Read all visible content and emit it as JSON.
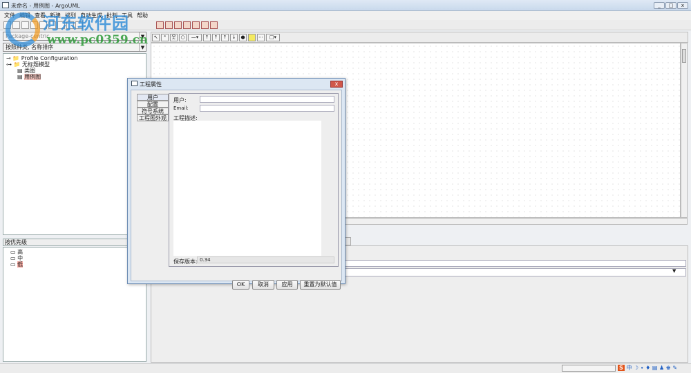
{
  "window": {
    "title": "未命名 - 用例图 - ArgoUML",
    "min": "_",
    "max": "□",
    "close": "x"
  },
  "menu": [
    "文件",
    "编辑",
    "查看",
    "新建",
    "排列",
    "自动生成",
    "批判",
    "工具",
    "帮助"
  ],
  "explorer": {
    "perspective": "Package-centric",
    "order": "按照种类, 名称排序",
    "tree": [
      "Profile Configuration",
      "无标题模型",
      "类图",
      "用例图"
    ]
  },
  "todo": {
    "header": "按优先级",
    "items": [
      "高",
      "中",
      "低"
    ]
  },
  "watermark": {
    "line1": "河东软件园",
    "line2": "www.pc0359.cn"
  },
  "dialog": {
    "title": "工程属性",
    "tabs": [
      "用户",
      "配置",
      "符号系统",
      "工程图外观"
    ],
    "user_label": "用户:",
    "user_value": "",
    "email_label": "Email:",
    "email_value": "",
    "desc_label": "工程描述:",
    "desc_value": "",
    "version_label": "保存版本:",
    "version_value": "0.34",
    "buttons": {
      "ok": "OK",
      "cancel": "取消",
      "apply": "应用",
      "reset": "重置为默认值"
    }
  },
  "ime": {
    "brand": "S",
    "lang": "中"
  }
}
